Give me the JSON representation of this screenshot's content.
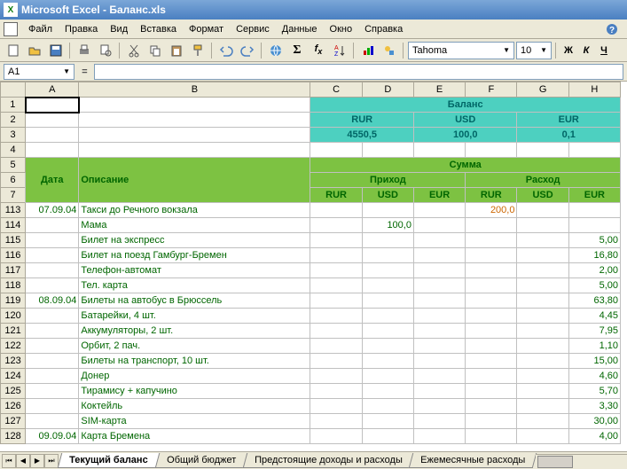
{
  "window": {
    "title": "Microsoft Excel - Баланс.xls"
  },
  "menu": {
    "items": [
      "Файл",
      "Правка",
      "Вид",
      "Вставка",
      "Формат",
      "Сервис",
      "Данные",
      "Окно",
      "Справка"
    ]
  },
  "toolbar": {
    "font": "Tahoma",
    "size": "10",
    "bold": "Ж",
    "italic": "К",
    "underline": "Ч"
  },
  "namebox": {
    "ref": "A1"
  },
  "balance": {
    "title": "Баланс",
    "cols": [
      "RUR",
      "USD",
      "EUR"
    ],
    "vals": [
      "4550,5",
      "100,0",
      "0,1"
    ]
  },
  "hdr": {
    "date": "Дата",
    "desc": "Описание",
    "sum": "Сумма",
    "income": "Приход",
    "expense": "Расход",
    "rur": "RUR",
    "usd": "USD",
    "eur": "EUR"
  },
  "rows": [
    {
      "n": "113",
      "date": "07.09.04",
      "desc": "Такси до Речного вокзала",
      "f": "200,0"
    },
    {
      "n": "114",
      "date": "",
      "desc": "Мама",
      "d": "100,0"
    },
    {
      "n": "115",
      "date": "",
      "desc": "Билет на экспресс",
      "h": "5,00"
    },
    {
      "n": "116",
      "date": "",
      "desc": "Билет на поезд Гамбург-Бремен",
      "h": "16,80"
    },
    {
      "n": "117",
      "date": "",
      "desc": "Телефон-автомат",
      "h": "2,00"
    },
    {
      "n": "118",
      "date": "",
      "desc": "Тел. карта",
      "h": "5,00"
    },
    {
      "n": "119",
      "date": "08.09.04",
      "desc": "Билеты на автобус в Брюссель",
      "h": "63,80"
    },
    {
      "n": "120",
      "date": "",
      "desc": "Батарейки, 4 шт.",
      "h": "4,45"
    },
    {
      "n": "121",
      "date": "",
      "desc": "Аккумуляторы, 2 шт.",
      "h": "7,95"
    },
    {
      "n": "122",
      "date": "",
      "desc": "Орбит, 2 пач.",
      "h": "1,10"
    },
    {
      "n": "123",
      "date": "",
      "desc": "Билеты на транспорт, 10 шт.",
      "h": "15,00"
    },
    {
      "n": "124",
      "date": "",
      "desc": "Донер",
      "h": "4,60"
    },
    {
      "n": "125",
      "date": "",
      "desc": "Тирамису + капучино",
      "h": "5,70"
    },
    {
      "n": "126",
      "date": "",
      "desc": "Коктейль",
      "h": "3,30"
    },
    {
      "n": "127",
      "date": "",
      "desc": "SIM-карта",
      "h": "30,00"
    },
    {
      "n": "128",
      "date": "09.09.04",
      "desc": "Карта Бремена",
      "h": "4,00"
    }
  ],
  "tabs": {
    "items": [
      "Текущий баланс",
      "Общий бюджет",
      "Предстоящие доходы и расходы",
      "Ежемесячные расходы"
    ],
    "active": 0
  },
  "colheads": [
    "A",
    "B",
    "C",
    "D",
    "E",
    "F",
    "G",
    "H"
  ]
}
